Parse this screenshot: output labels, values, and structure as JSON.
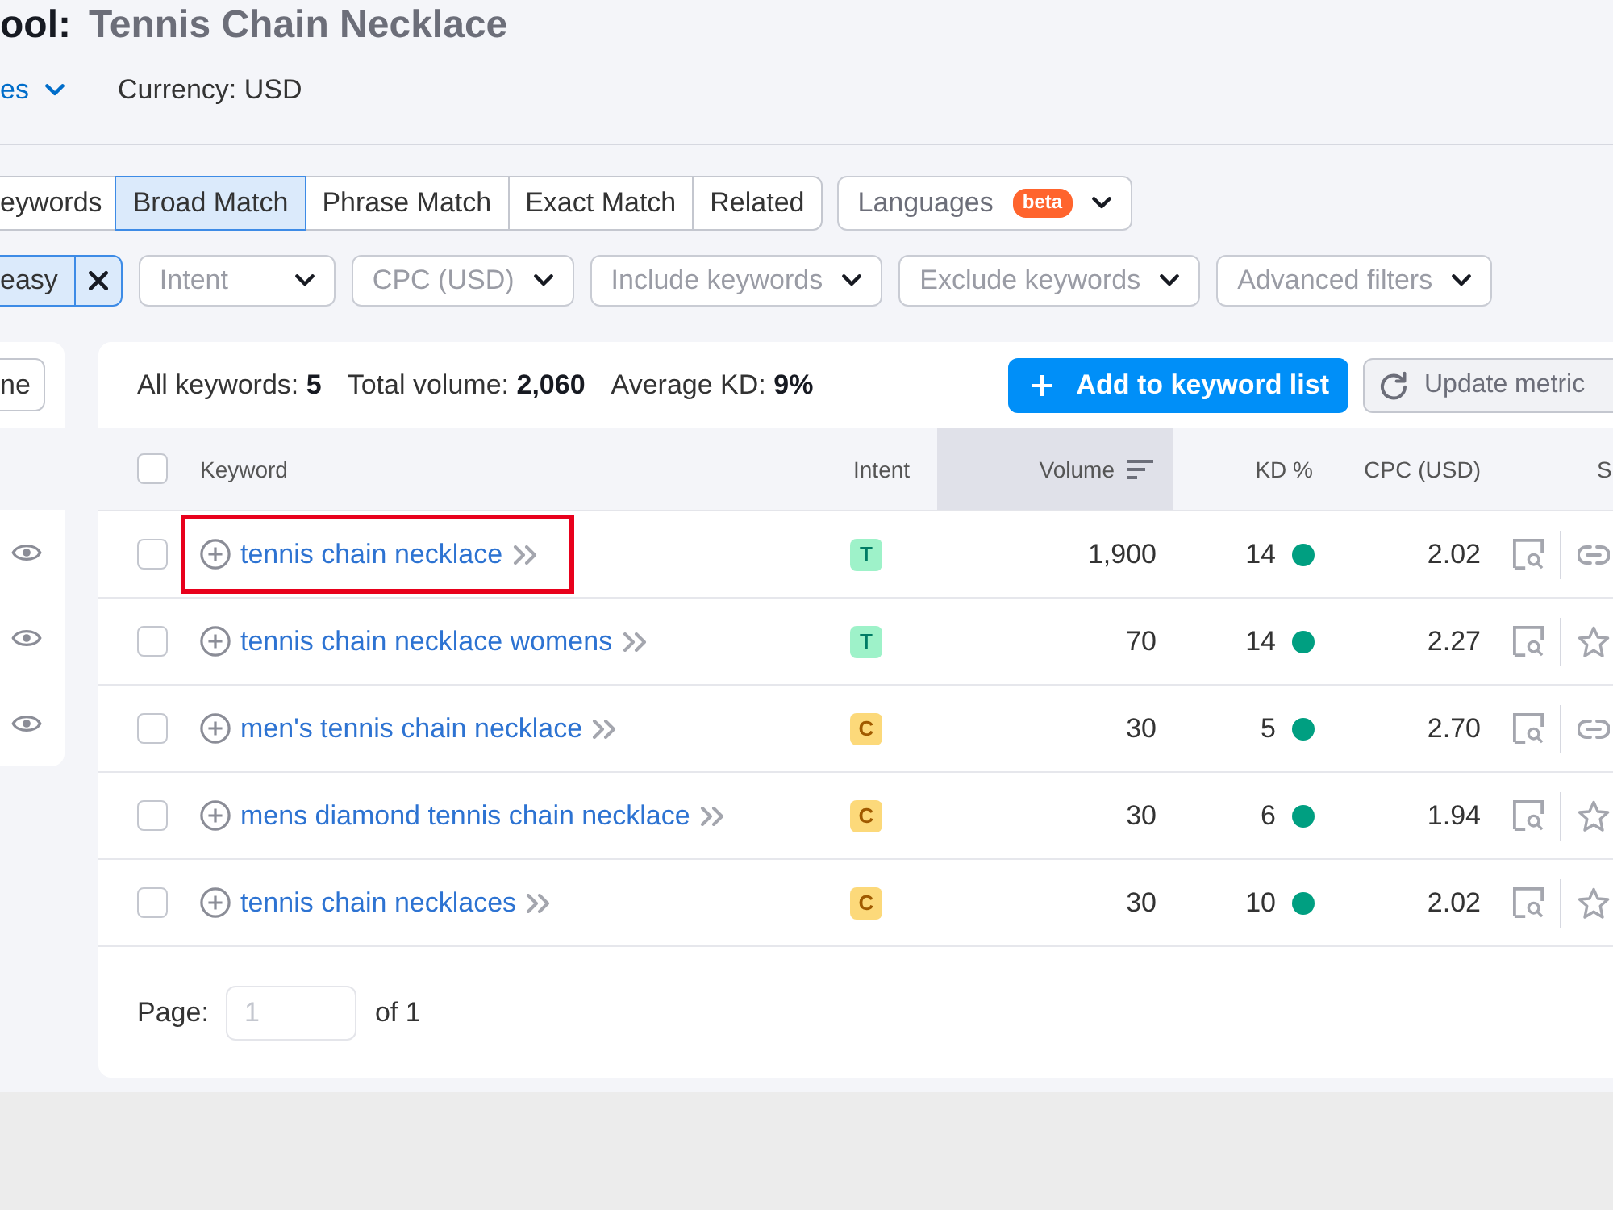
{
  "title": {
    "tool": "ool:",
    "query": "Tennis Chain Necklace"
  },
  "subheader": {
    "selector": {
      "label": "es"
    },
    "currency": "Currency: USD"
  },
  "tabs": [
    {
      "label": "eywords",
      "selected": false
    },
    {
      "label": "Broad Match",
      "selected": true
    },
    {
      "label": "Phrase Match",
      "selected": false
    },
    {
      "label": "Exact Match",
      "selected": false
    },
    {
      "label": "Related",
      "selected": false
    }
  ],
  "languages": {
    "label": "Languages",
    "badge": "beta"
  },
  "active_filter": {
    "label": "easy"
  },
  "filters": [
    {
      "label": "Intent"
    },
    {
      "label": "CPC (USD)"
    },
    {
      "label": "Include keywords"
    },
    {
      "label": "Exclude keywords"
    },
    {
      "label": "Advanced filters"
    }
  ],
  "side_panel": {
    "button": "ne",
    "rows": [
      {
        "visible": true
      },
      {
        "visible": true
      },
      {
        "visible": true
      }
    ]
  },
  "summary": [
    {
      "label": "All keywords:",
      "value": "5"
    },
    {
      "label": "Total volume:",
      "value": "2,060"
    },
    {
      "label": "Average KD:",
      "value": "9%"
    }
  ],
  "actions": [
    {
      "kind": "primary",
      "label": "Add to keyword list"
    },
    {
      "kind": "secondary",
      "label": "Update metric"
    }
  ],
  "table": {
    "select_all": {
      "checked": false
    },
    "columns": [
      {
        "label": "Keyword",
        "sorted": false
      },
      {
        "label": "Intent",
        "sorted": false
      },
      {
        "label": "Volume",
        "sorted": true
      },
      {
        "label": "KD %",
        "sorted": false
      },
      {
        "label": "CPC (USD)",
        "sorted": false
      },
      {
        "label": "S",
        "sorted": false
      }
    ],
    "rows": [
      {
        "checked": false,
        "keyword": "tennis chain necklace",
        "highlighted": true,
        "intent": {
          "label": "T",
          "kind": "transactional"
        },
        "volume": "1,900",
        "kd": {
          "value": "14",
          "color": "#009f81"
        },
        "cpc": "2.02",
        "serp_feature": {
          "kind": "link"
        }
      },
      {
        "checked": false,
        "keyword": "tennis chain necklace womens",
        "highlighted": false,
        "intent": {
          "label": "T",
          "kind": "transactional"
        },
        "volume": "70",
        "kd": {
          "value": "14",
          "color": "#009f81"
        },
        "cpc": "2.27",
        "serp_feature": {
          "kind": "star"
        }
      },
      {
        "checked": false,
        "keyword": "men's tennis chain necklace",
        "highlighted": false,
        "intent": {
          "label": "C",
          "kind": "commercial"
        },
        "volume": "30",
        "kd": {
          "value": "5",
          "color": "#009f81"
        },
        "cpc": "2.70",
        "serp_feature": {
          "kind": "link"
        }
      },
      {
        "checked": false,
        "keyword": "mens diamond tennis chain necklace",
        "highlighted": false,
        "intent": {
          "label": "C",
          "kind": "commercial"
        },
        "volume": "30",
        "kd": {
          "value": "6",
          "color": "#009f81"
        },
        "cpc": "1.94",
        "serp_feature": {
          "kind": "star"
        }
      },
      {
        "checked": false,
        "keyword": "tennis chain necklaces",
        "highlighted": false,
        "intent": {
          "label": "C",
          "kind": "commercial"
        },
        "volume": "30",
        "kd": {
          "value": "10",
          "color": "#009f81"
        },
        "cpc": "2.02",
        "serp_feature": {
          "kind": "star"
        }
      }
    ]
  },
  "pagination": {
    "label": "Page:",
    "input": {
      "placeholder": "1"
    },
    "total": "of 1"
  }
}
